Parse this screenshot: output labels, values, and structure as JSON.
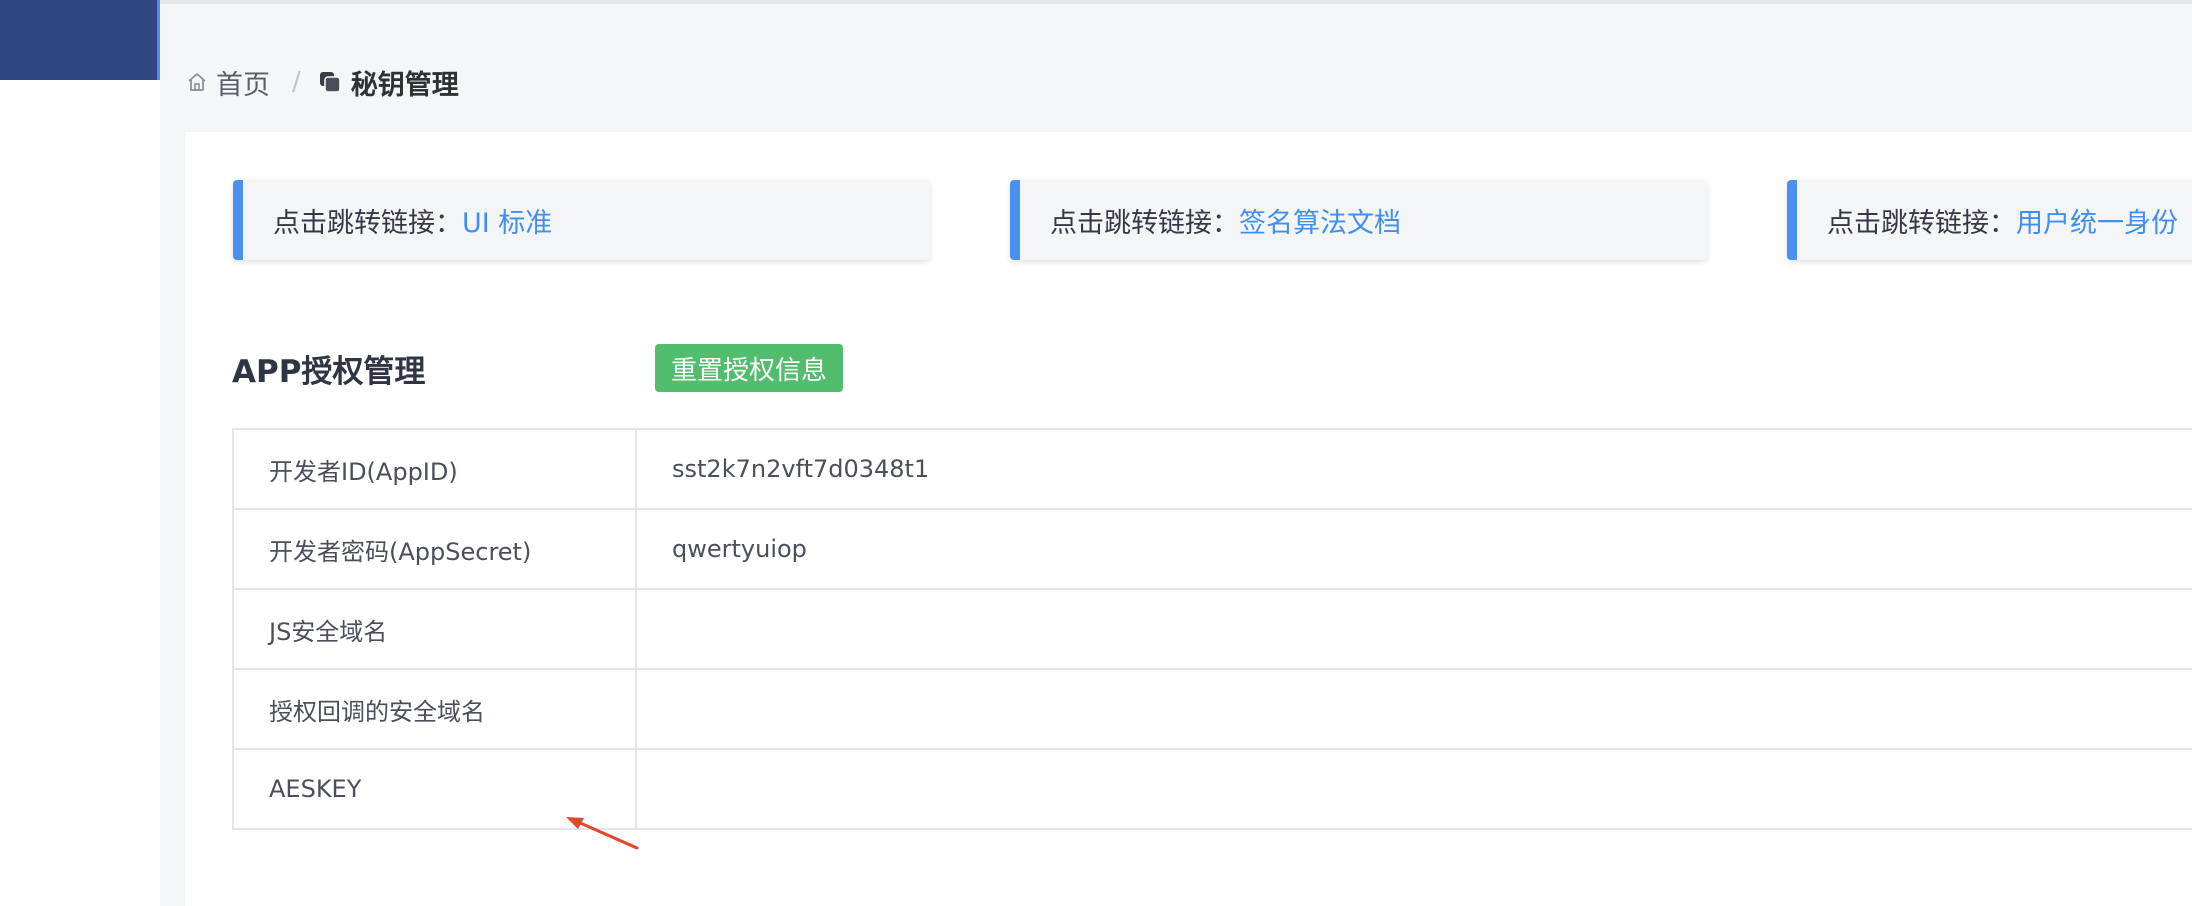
{
  "breadcrumb": {
    "home_icon": "home-icon",
    "home": "首页",
    "separator": "/",
    "current_icon": "key-manage-icon",
    "current": "秘钥管理"
  },
  "link_cards": [
    {
      "prefix": "点击跳转链接：",
      "link": "UI 标准"
    },
    {
      "prefix": "点击跳转链接：",
      "link": "签名算法文档"
    },
    {
      "prefix": "点击跳转链接：",
      "link": "用户统一身份"
    }
  ],
  "section": {
    "title": "APP授权管理",
    "reset_button": "重置授权信息"
  },
  "auth_rows": [
    {
      "label": "开发者ID(AppID)",
      "value": "sst2k7n2vft7d0348t1"
    },
    {
      "label": "开发者密码(AppSecret)",
      "value": "qwertyuiop"
    },
    {
      "label": "JS安全域名",
      "value": ""
    },
    {
      "label": "授权回调的安全域名",
      "value": ""
    },
    {
      "label": "AESKEY",
      "value": ""
    }
  ],
  "colors": {
    "sidebar": "#304782",
    "accent": "#4a90f1",
    "link": "#3f8ef0",
    "success_button": "#52bd6c",
    "annotation_arrow": "#e2462b"
  }
}
